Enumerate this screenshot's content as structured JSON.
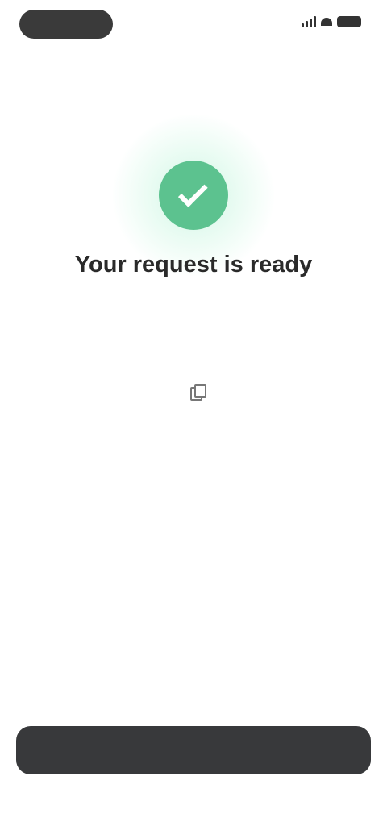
{
  "status_bar": {
    "pill_icon": "dynamic-island",
    "icons": [
      "signal-icon",
      "wifi-icon",
      "battery-icon"
    ]
  },
  "hero": {
    "icon": "check-icon",
    "accent_color": "#5cc28f"
  },
  "title": "Your request is ready",
  "subtitle": "",
  "link": {
    "text": "",
    "copy_icon": "copy-icon"
  },
  "footnote": "",
  "primary_button": {
    "label": ""
  }
}
